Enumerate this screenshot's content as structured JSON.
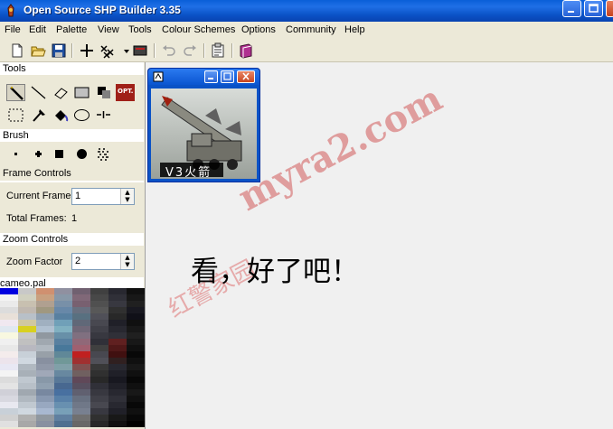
{
  "window": {
    "title": "Open Source SHP Builder 3.35"
  },
  "menu": [
    "File",
    "Edit",
    "Palette",
    "View",
    "Tools",
    "Colour Schemes",
    "Options",
    "Community",
    "Help"
  ],
  "toolbar": {
    "icons": [
      "new-file-icon",
      "open-folder-icon",
      "save-icon",
      "crosshair-icon",
      "checker-icon",
      "dropdown-arrow-icon",
      "preview-icon",
      "undo-icon",
      "redo-icon",
      "properties-icon",
      "book-icon"
    ]
  },
  "left_panel": {
    "tools_header": "Tools",
    "opt_label": "OPT.",
    "brush_header": "Brush",
    "frame_controls_header": "Frame Controls",
    "current_frame_label": "Current Frame",
    "current_frame_value": "1",
    "total_frames_label": "Total Frames:",
    "total_frames_value": "1",
    "zoom_controls_header": "Zoom Controls",
    "zoom_factor_label": "Zoom Factor",
    "zoom_factor_value": "2",
    "palette_name": "cameo.pal"
  },
  "child_window": {
    "image_caption": "V3火箭"
  },
  "workspace": {
    "message": "看，好了吧！",
    "watermark_site": "myra2.com",
    "watermark_cn": "红警家园"
  },
  "colors": {
    "titlebar": "#0a52c6",
    "workspace": "#f0f0f0",
    "watermark": "#d25a5a"
  }
}
